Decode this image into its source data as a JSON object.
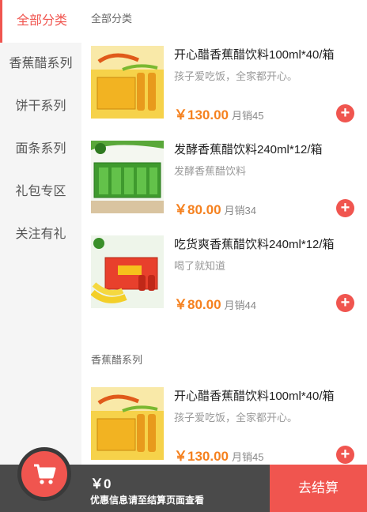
{
  "sidebar": {
    "items": [
      {
        "label": "全部分类"
      },
      {
        "label": "香蕉醋系列"
      },
      {
        "label": "饼干系列"
      },
      {
        "label": "面条系列"
      },
      {
        "label": "礼包专区"
      },
      {
        "label": "关注有礼"
      }
    ]
  },
  "sections": [
    {
      "title": "全部分类",
      "products": [
        {
          "name": "开心醋香蕉醋饮料100ml*40/箱",
          "desc": "孩子爱吃饭，全家都开心。",
          "price": "￥130.00",
          "sales": "月销45"
        },
        {
          "name": "发酵香蕉醋饮料240ml*12/箱",
          "desc": "发酵香蕉醋饮料",
          "price": "￥80.00",
          "sales": "月销34"
        },
        {
          "name": "吃货爽香蕉醋饮料240ml*12/箱",
          "desc": "喝了就知道",
          "price": "￥80.00",
          "sales": "月销44"
        }
      ]
    },
    {
      "title": "香蕉醋系列",
      "products": [
        {
          "name": "开心醋香蕉醋饮料100ml*40/箱",
          "desc": "孩子爱吃饭，全家都开心。",
          "price": "￥130.00",
          "sales": "月销45"
        }
      ]
    }
  ],
  "cart": {
    "total": "￥0",
    "note": "优惠信息请至结算页面查看",
    "checkout_label": "去结算"
  },
  "colors": {
    "accent": "#f0554f",
    "price": "#f5811f",
    "cartbar": "#4a4a4a"
  },
  "icons": {
    "add": "plus-icon",
    "cart": "shopping-cart-icon"
  }
}
